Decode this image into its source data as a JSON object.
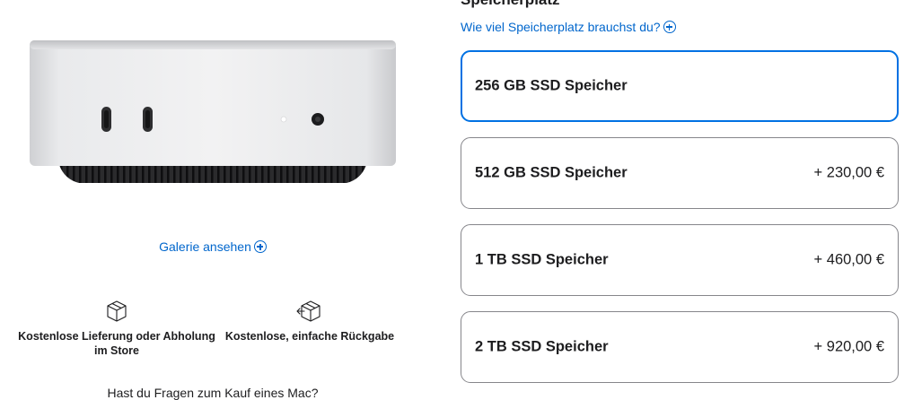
{
  "gallery": {
    "label": "Galerie ansehen"
  },
  "services": [
    {
      "label": "Kostenlose Lieferung oder Abholung im Store",
      "icon": "box-icon"
    },
    {
      "label": "Kostenlose, einfache Rückgabe",
      "icon": "box-return-icon"
    }
  ],
  "questions": {
    "label": "Hast du Fragen zum Kauf eines Mac?"
  },
  "storage": {
    "title": "Speicherplatz",
    "help_link": "Wie viel Speicherplatz brauchst du?",
    "options": [
      {
        "label": "256 GB SSD Speicher",
        "price": "",
        "selected": true
      },
      {
        "label": "512 GB SSD Speicher",
        "price": "+ 230,00 €",
        "selected": false
      },
      {
        "label": "1 TB SSD Speicher",
        "price": "+ 460,00 €",
        "selected": false
      },
      {
        "label": "2 TB SSD Speicher",
        "price": "+ 920,00 €",
        "selected": false
      }
    ]
  },
  "colors": {
    "accent": "#0066cc",
    "selected_border": "#0071e3",
    "border": "#86868b"
  }
}
